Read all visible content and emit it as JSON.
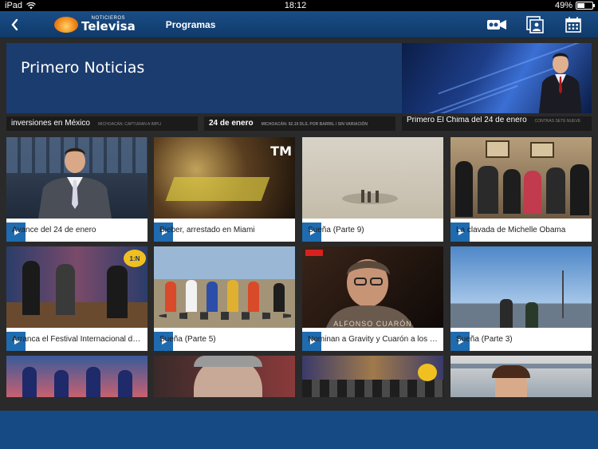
{
  "status_bar": {
    "device": "iPad",
    "time": "18:12",
    "battery": "49%",
    "battery_level": 0.49
  },
  "nav": {
    "logo_small": "NOTICIEROS",
    "logo_big": "Televisa",
    "title": "Programas"
  },
  "banner": {
    "title": "Primero Noticias"
  },
  "tickers": [
    {
      "text": "inversiones en México",
      "sub": "MICHOACÁN: CAPTURAN A IMPLI"
    },
    {
      "text": "24 de enero",
      "sub": "MICHOACÁN: 92.19 DLS. POR BARRIL / SIN VARIACIÓN"
    },
    {
      "text": "Primero El Chima del 24 de enero",
      "sub": "CONTRAS SETE NUEVE"
    }
  ],
  "videos": [
    {
      "title": "Avance del 24 de enero",
      "scene": "anchor-studio"
    },
    {
      "title": "Bieber, arrestado en Miami",
      "scene": "night-car",
      "tag": "TM"
    },
    {
      "title": "Sueña (Parte 9)",
      "scene": "desert"
    },
    {
      "title": "La clavada de Michelle Obama",
      "scene": "living-room"
    },
    {
      "title": "Arranca el Festival Internacional de...",
      "scene": "talk-show",
      "tag": "1:N"
    },
    {
      "title": "Sueña (Parte 5)",
      "scene": "cyclists"
    },
    {
      "title": "Nominan a Gravity y Cuarón a los 'P...",
      "scene": "portrait",
      "tag": "ALFONSO CUARÓN"
    },
    {
      "title": "Sueña (Parte 3)",
      "scene": "sky-street"
    },
    {
      "title": "",
      "scene": "cheerleaders"
    },
    {
      "title": "",
      "scene": "face-closeup"
    },
    {
      "title": "",
      "scene": "studio-panel"
    },
    {
      "title": "",
      "scene": "woman-outdoor"
    }
  ]
}
